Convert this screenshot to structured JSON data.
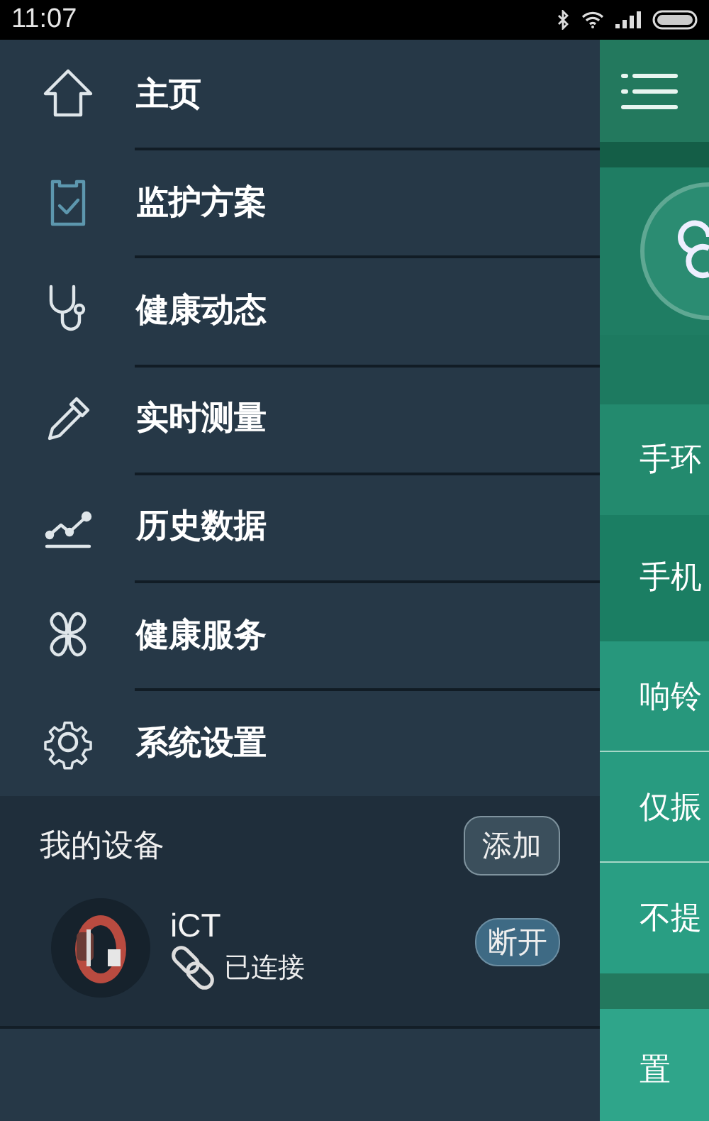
{
  "status_bar": {
    "time": "11:07"
  },
  "menu": [
    {
      "label": "主页",
      "selected": false
    },
    {
      "label": "监护方案",
      "selected": true
    },
    {
      "label": "健康动态",
      "selected": false
    },
    {
      "label": "实时测量",
      "selected": false
    },
    {
      "label": "历史数据",
      "selected": false
    },
    {
      "label": "健康服务",
      "selected": false
    },
    {
      "label": "系统设置",
      "selected": false
    }
  ],
  "devices": {
    "title": "我的设备",
    "add_button": "添加",
    "items": [
      {
        "name": "iCT",
        "status": "已连接",
        "connected": true,
        "action": "断开"
      }
    ]
  },
  "behind_screen": {
    "rows": [
      {
        "label": "手环"
      },
      {
        "label": "手机"
      },
      {
        "label": "响铃"
      },
      {
        "label": "仅振"
      },
      {
        "label": "不提"
      },
      {
        "label": "置"
      }
    ]
  }
}
